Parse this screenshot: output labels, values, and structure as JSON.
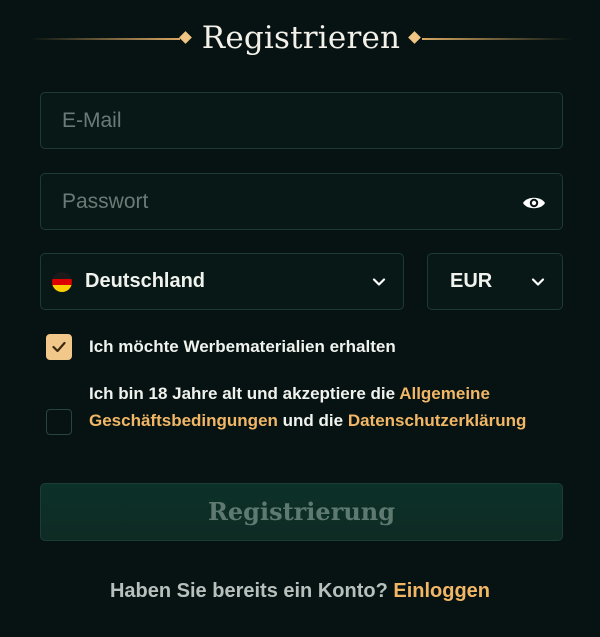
{
  "header": {
    "title": "Registrieren"
  },
  "form": {
    "email_placeholder": "E-Mail",
    "password_placeholder": "Passwort",
    "country": {
      "selected": "Deutschland",
      "flag_colors": [
        "#000000",
        "#dd0000",
        "#ffce00"
      ]
    },
    "currency": {
      "selected": "EUR"
    },
    "promo_checkbox": {
      "label": "Ich möchte Werbematerialien erhalten",
      "checked": true
    },
    "terms_checkbox": {
      "prefix": "Ich bin 18 Jahre alt und akzeptiere die ",
      "link1": "Allgemeine Geschäftsbedingungen",
      "middle": " und die ",
      "link2": "Datenschutzerklärung",
      "checked": false
    },
    "submit_label": "Registrierung"
  },
  "footer": {
    "question": "Haben Sie bereits ein Konto?",
    "login_link": "Einloggen"
  },
  "colors": {
    "background": "#061312",
    "accent": "#f2b766",
    "checkbox_fill": "#f2c88a",
    "button_bg": "#0c3128"
  },
  "icons": {
    "password_toggle": "eye-icon",
    "dropdown": "chevron-down-icon",
    "checkmark": "check-icon"
  }
}
